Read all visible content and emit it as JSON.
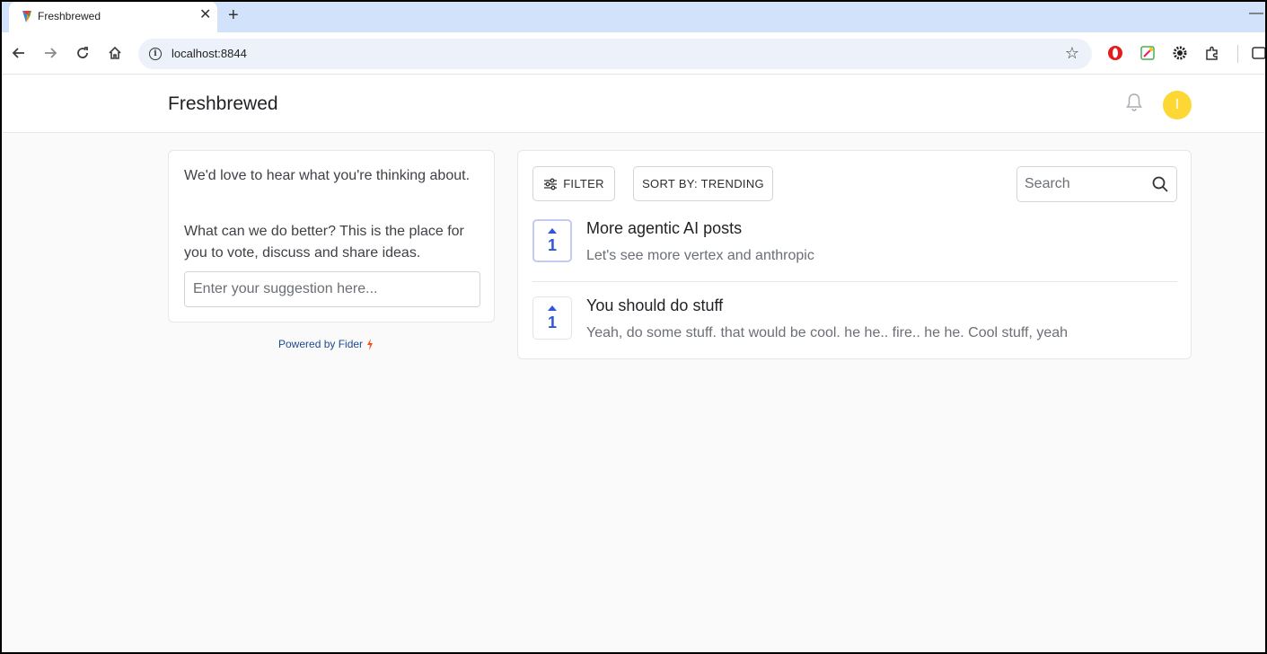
{
  "browser": {
    "tab_title": "Freshbrewed",
    "url": "localhost:8844",
    "icons": {
      "back": "arrow-left-icon",
      "forward": "arrow-right-icon",
      "reload": "reload-icon",
      "home": "home-icon",
      "info": "site-info-icon",
      "star": "bookmark-star-icon",
      "extensions": [
        "opera-icon",
        "color-picker-icon",
        "gear-icon",
        "puzzle-icon",
        "side-panel-icon"
      ]
    }
  },
  "header": {
    "brand": "Freshbrewed",
    "avatar_letter": "I",
    "avatar_color": "#fdd835"
  },
  "sidebar": {
    "intro": "We'd love to hear what you're thinking about.",
    "prompt": "What can we do better? This is the place for you to vote, discuss and share ideas.",
    "suggestion_placeholder": "Enter your suggestion here...",
    "powered_by": "Powered by Fider"
  },
  "toolbar": {
    "filter_label": "FILTER",
    "sort_label": "SORT BY: TRENDING",
    "search_placeholder": "Search"
  },
  "posts": [
    {
      "votes": "1",
      "title": "More agentic AI posts",
      "description": "Let's see more vertex and anthropic"
    },
    {
      "votes": "1",
      "title": "You should do stuff",
      "description": "Yeah, do some stuff. that would be cool. he he.. fire.. he he. Cool stuff, yeah"
    }
  ],
  "colors": {
    "accent": "#2f56d8",
    "page_bg": "#fbfafb",
    "tabstrip_bg": "#d3e2fb"
  }
}
